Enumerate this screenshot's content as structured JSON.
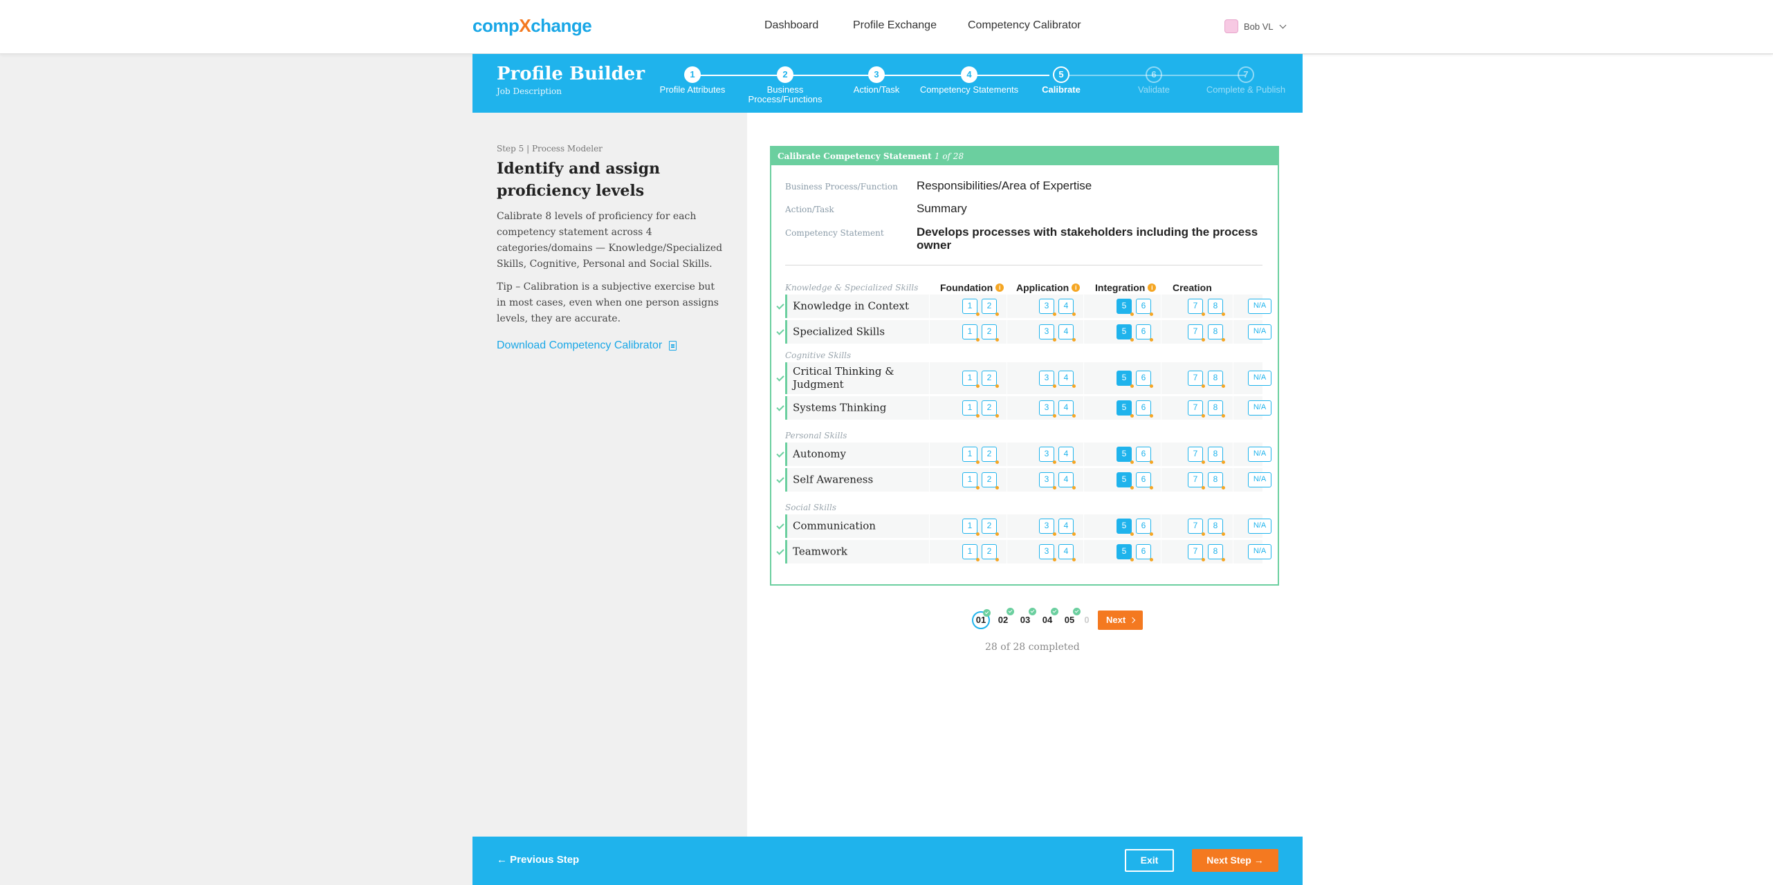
{
  "header": {
    "logo_pre": "comp",
    "logo_x": "X",
    "logo_post": "change",
    "nav": [
      "Dashboard",
      "Profile Exchange",
      "Competency Calibrator"
    ],
    "user_name": "Bob VL"
  },
  "banner": {
    "title": "Profile Builder",
    "subtitle": "Job Description",
    "steps": [
      {
        "num": "1",
        "label": "Profile Attributes",
        "state": "done"
      },
      {
        "num": "2",
        "label": "Business Process/Functions",
        "state": "done"
      },
      {
        "num": "3",
        "label": "Action/Task",
        "state": "done"
      },
      {
        "num": "4",
        "label": "Competency Statements",
        "state": "done"
      },
      {
        "num": "5",
        "label": "Calibrate",
        "state": "current"
      },
      {
        "num": "6",
        "label": "Validate",
        "state": "future"
      },
      {
        "num": "7",
        "label": "Complete & Publish",
        "state": "future"
      }
    ]
  },
  "left": {
    "step_crumb": "Step 5 | Process Modeler",
    "title": "Identify and assign proficiency levels",
    "paragraph1": "Calibrate 8 levels of proficiency for each competency statement across 4 categories/domains — Knowledge/Specialized Skills, Cognitive, Personal and Social Skills.",
    "paragraph2": "Tip – Calibration is a subjective exercise but in most cases, even when one person assigns levels, they are accurate.",
    "download_label": "Download Competency Calibrator"
  },
  "card": {
    "header_prefix": "Calibrate Competency Statement",
    "header_count": "1 of 28",
    "meta": {
      "bp_key": "Business Process/Function",
      "bp_val": "Responsibilities/Area of Expertise",
      "at_key": "Action/Task",
      "at_val": "Summary",
      "cs_key": "Competency Statement",
      "cs_val": "Develops processes with stakeholders including the process owner"
    },
    "levels": [
      "Foundation",
      "Application",
      "Integration",
      "Creation"
    ],
    "na_label": "N/A",
    "categories": [
      {
        "name": "Knowledge & Specialized Skills",
        "rows": [
          "Knowledge in Context",
          "Specialized Skills"
        ]
      },
      {
        "name": "Cognitive Skills",
        "rows": [
          "Critical Thinking & Judgment",
          "Systems Thinking"
        ]
      },
      {
        "name": "Personal Skills",
        "rows": [
          "Autonomy",
          "Self Awareness"
        ]
      },
      {
        "name": "Social Skills",
        "rows": [
          "Communication",
          "Teamwork"
        ]
      }
    ],
    "selected_level": 5
  },
  "pager": {
    "pages": [
      "01",
      "02",
      "03",
      "04",
      "05",
      "0"
    ],
    "next_label": "Next",
    "completed_text": "28 of 28 completed"
  },
  "footer": {
    "prev_label": "← Previous Step",
    "exit_label": "Exit",
    "next_step_label": "Next Step →"
  },
  "colors": {
    "primary_blue": "#1fb3ec",
    "accent_orange": "#f47920",
    "success_green": "#6bcf9f",
    "info_yellow": "#f5a623"
  }
}
